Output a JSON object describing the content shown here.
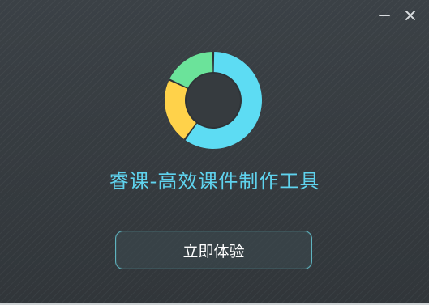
{
  "window": {
    "title": "睿课-高效课件制作工具",
    "controls": {
      "minimize_icon": "minimize-icon",
      "close_icon": "close-icon"
    }
  },
  "logo": {
    "icon": "donut-chart-logo",
    "segments": [
      {
        "color": "#5ddcf3",
        "share": 0.6
      },
      {
        "color": "#ffd24a",
        "share": 0.22
      },
      {
        "color": "#6be39a",
        "share": 0.18
      }
    ]
  },
  "main": {
    "title": "睿课-高效课件制作工具",
    "start_button": "立即体验"
  },
  "colors": {
    "accent": "#5fd3ee",
    "button_border": "#5fb3bf",
    "background": "#353a3e"
  }
}
